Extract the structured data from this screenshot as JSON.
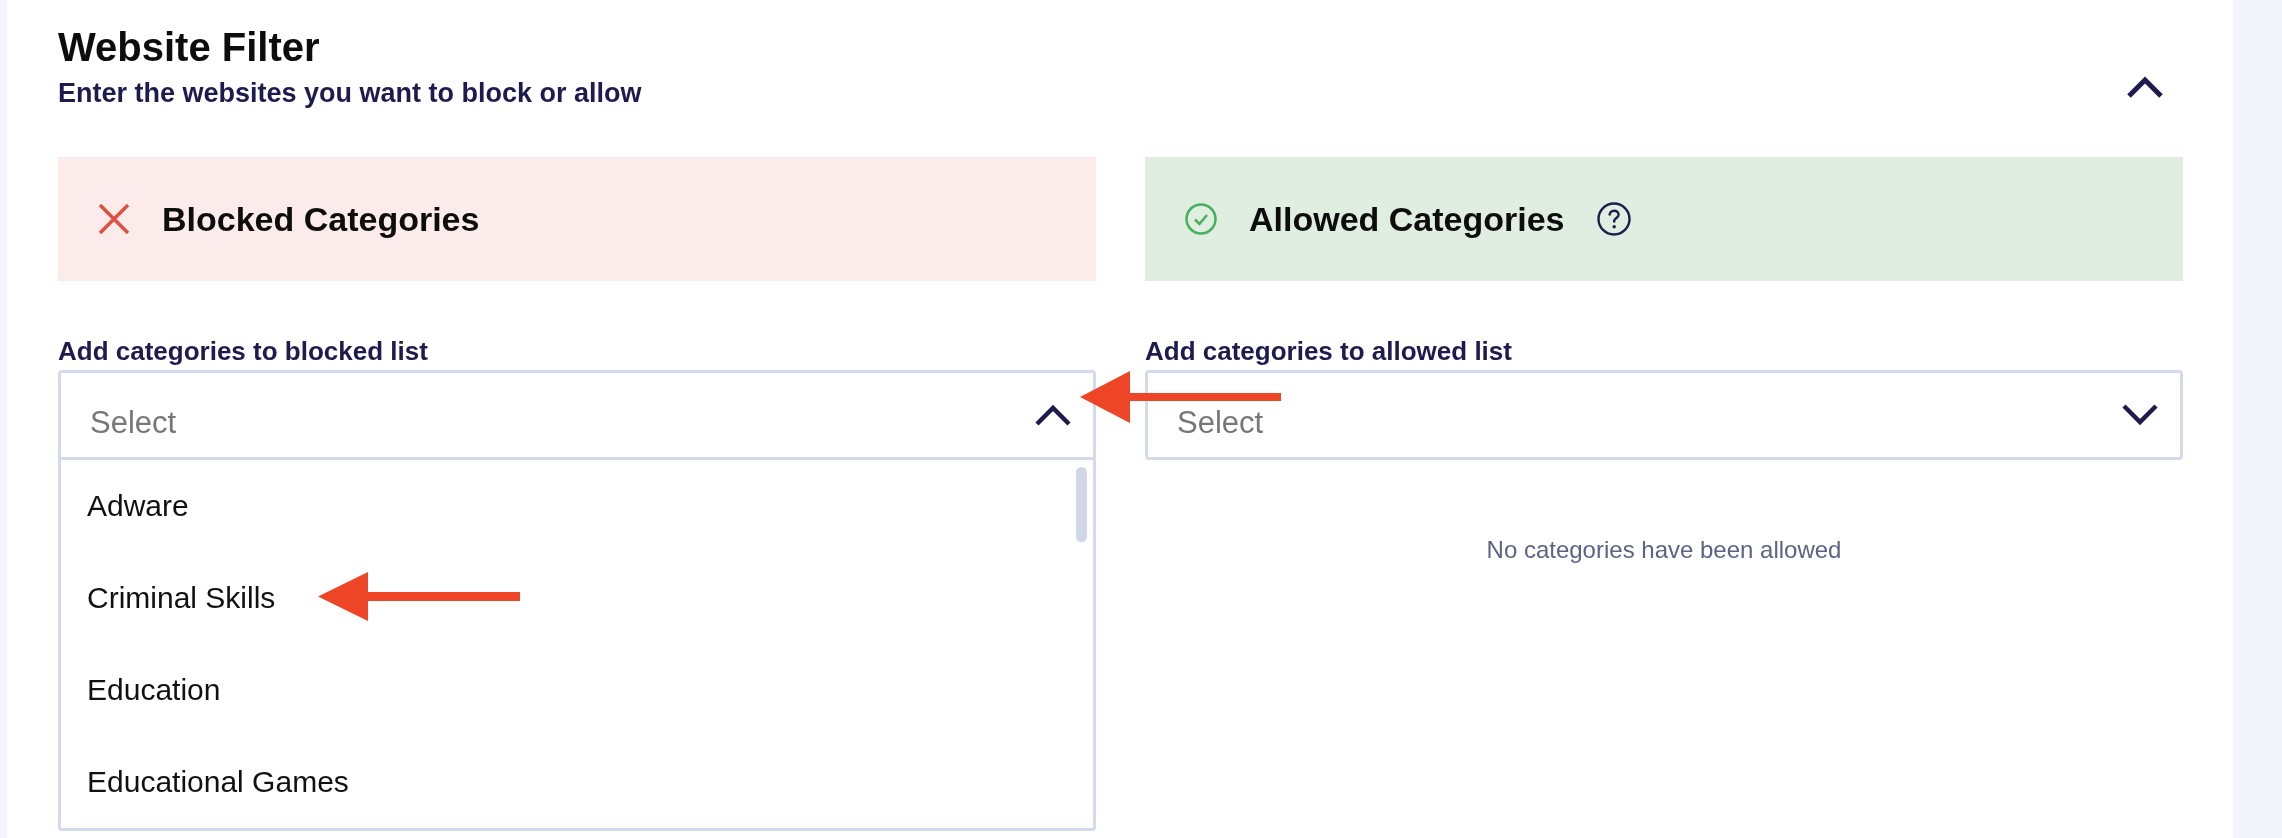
{
  "section": {
    "title": "Website Filter",
    "subtitle": "Enter the websites you want to block or allow",
    "expanded": true
  },
  "panels": [
    {
      "kind": "blocked",
      "heading": "Blocked Categories",
      "help": false,
      "field_label": "Add categories to blocked list",
      "select": {
        "placeholder": "Select",
        "expanded": true,
        "options": [
          {
            "label": "Adware",
            "selected": false
          },
          {
            "label": "Criminal Skills",
            "selected": false
          },
          {
            "label": "Education",
            "selected": false
          },
          {
            "label": "Educational Games",
            "selected": false
          }
        ]
      }
    },
    {
      "kind": "allowed",
      "heading": "Allowed Categories",
      "help": true,
      "field_label": "Add categories to allowed list",
      "select": {
        "placeholder": "Select",
        "expanded": false
      },
      "empty_message": "No categories have been allowed"
    }
  ]
}
